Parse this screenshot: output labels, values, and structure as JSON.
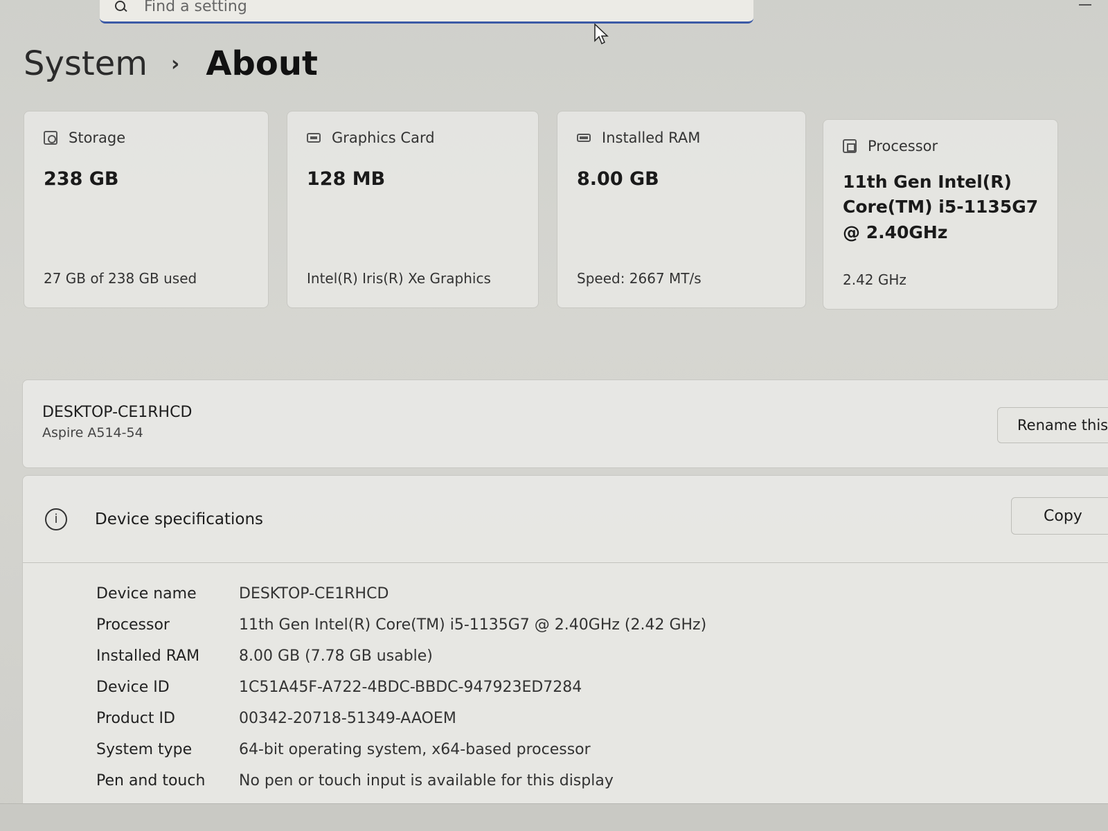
{
  "search": {
    "placeholder": "Find a setting"
  },
  "breadcrumb": {
    "parent": "System",
    "separator": "›",
    "current": "About"
  },
  "cards": [
    {
      "title": "Storage",
      "value": "238 GB",
      "sub": "27 GB of 238 GB used",
      "icon": "storage-icon"
    },
    {
      "title": "Graphics Card",
      "value": "128 MB",
      "sub": "Intel(R) Iris(R) Xe Graphics",
      "icon": "graphics-card-icon"
    },
    {
      "title": "Installed RAM",
      "value": "8.00 GB",
      "sub": "Speed: 2667 MT/s",
      "icon": "ram-icon"
    },
    {
      "title": "Processor",
      "value": "11th Gen Intel(R) Core(TM) i5-1135G7 @ 2.40GHz",
      "sub": "2.42 GHz",
      "icon": "processor-icon"
    }
  ],
  "device": {
    "name": "DESKTOP-CE1RHCD",
    "model": "Aspire A514-54",
    "rename_label": "Rename this PC"
  },
  "specs": {
    "title": "Device specifications",
    "copy_label": "Copy",
    "rows": [
      {
        "label": "Device name",
        "value": "DESKTOP-CE1RHCD"
      },
      {
        "label": "Processor",
        "value": "11th Gen Intel(R) Core(TM) i5-1135G7 @ 2.40GHz (2.42 GHz)"
      },
      {
        "label": "Installed RAM",
        "value": "8.00 GB (7.78 GB usable)"
      },
      {
        "label": "Device ID",
        "value": "1C51A45F-A722-4BDC-BBDC-947923ED7284"
      },
      {
        "label": "Product ID",
        "value": "00342-20718-51349-AAOEM"
      },
      {
        "label": "System type",
        "value": "64-bit operating system, x64-based processor"
      },
      {
        "label": "Pen and touch",
        "value": "No pen or touch input is available for this display"
      }
    ]
  }
}
